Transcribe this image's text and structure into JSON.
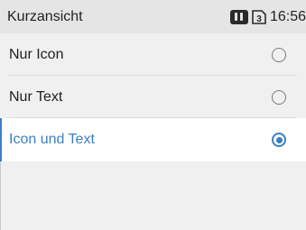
{
  "status_bar": {
    "title": "Kurzansicht",
    "sim_icon_2": "sim-card-icon",
    "sim_icon_3": "sim-3-icon",
    "sim3_label": "3",
    "time": "16:56"
  },
  "options": [
    {
      "label": "Nur Icon",
      "selected": false
    },
    {
      "label": "Nur Text",
      "selected": false
    },
    {
      "label": "Icon und Text",
      "selected": true
    }
  ],
  "colors": {
    "accent": "#3a7fc2",
    "status_bar_bg": "#e5e5e5",
    "page_bg": "#f0f0f0"
  }
}
